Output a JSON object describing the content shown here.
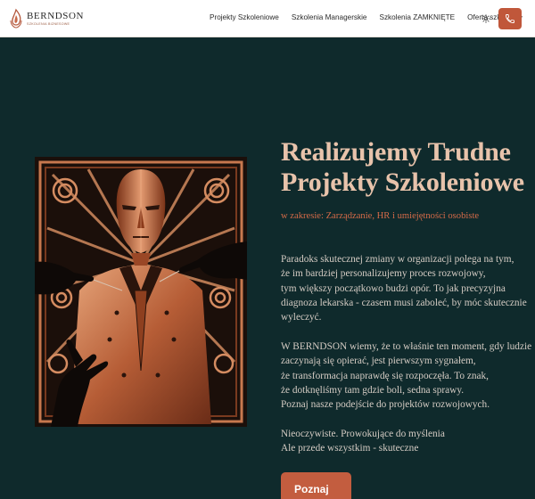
{
  "brand": {
    "name": "BERNDSON",
    "tagline": "SZKOLENIA BIZNESOWE"
  },
  "nav": {
    "items": [
      "Projekty Szkoleniowe",
      "Szkolenia Managerskie",
      "Szkolenia ZAMKNIĘTE"
    ],
    "dropdown_label": "Oferta szkoleń",
    "icons": [
      "chevron-down-icon",
      "sun-icon",
      "phone-icon"
    ]
  },
  "hero": {
    "title_line1": "Realizujemy Trudne",
    "title_line2": "Projekty Szkoleniowe",
    "subtitle": "w zakresie: Zarządzanie, HR i umiejętności osobiste",
    "paragraph1": [
      "Paradoks skutecznej zmiany w organizacji polega na tym,",
      "że im bardziej personalizujemy proces rozwojowy,",
      "tym większy początkowo budzi opór. To jak precyzyjna",
      "diagnoza lekarska - czasem musi zaboleć, by móc skutecznie",
      "wyleczyć."
    ],
    "paragraph2": [
      "W BERNDSON wiemy, że to właśnie ten moment, gdy ludzie",
      "zaczynają się opierać, jest pierwszym sygnałem,",
      "że transformacja naprawdę się rozpoczęła. To znak,",
      "że dotknęliśmy tam gdzie boli, sedna sprawy.",
      "Poznaj nasze podejście do projektów rozwojowych."
    ],
    "paragraph3": [
      "Nieoczywiste. Prowokujące do myślenia",
      "Ale przede wszystkim - skuteczne"
    ],
    "cta_label": "Poznaj"
  },
  "colors": {
    "background": "#0f2a2c",
    "accent": "#c0573a",
    "headline": "#e8c3ab",
    "subtitle": "#d46a48",
    "body_text": "#d5ccc4"
  }
}
